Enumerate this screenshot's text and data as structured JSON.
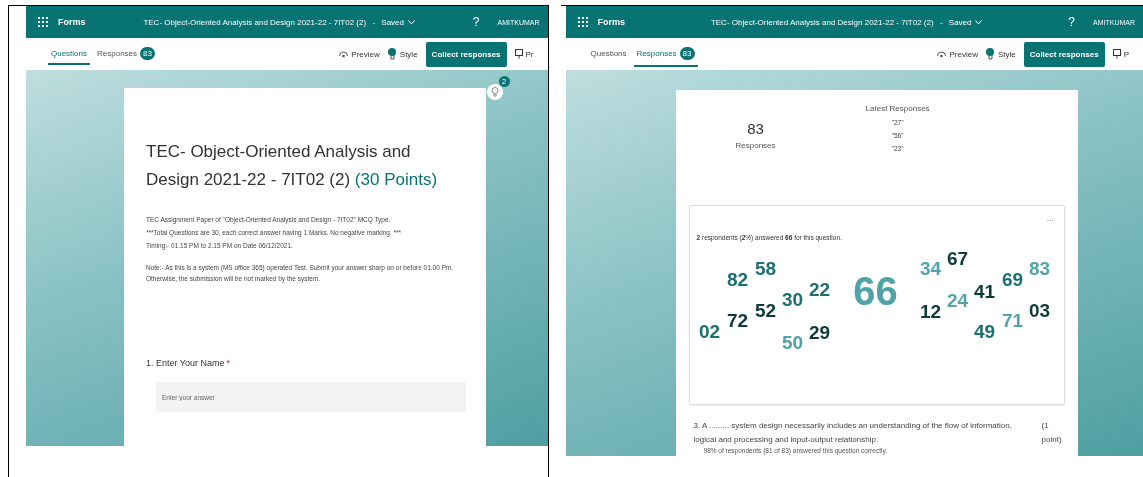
{
  "screens": [
    {
      "kind": "questions",
      "app": "Forms",
      "title": "TEC- Object-Oriented Analysis and Design 2021-22 - 7IT02 (2)",
      "separator": "-",
      "status": "Saved",
      "help": "?",
      "user": "AMITKUMAR",
      "tabs": [
        {
          "label": "Questions",
          "selected": true
        },
        {
          "label": "Responses",
          "selected": false,
          "count": "83"
        }
      ],
      "actions": {
        "preview": "Preview",
        "style": "Style",
        "collect": "Collect responses",
        "cut": "Pr"
      },
      "badge": "2",
      "form": {
        "title": "TEC- Object-Oriented Analysis and Design 2021-22 - 7IT02 (2)",
        "points": "(30 Points)",
        "description": [
          "TEC Assignment Paper of \"Object-Oriented Analysis and Design - 7IT02\" MCQ Type.",
          "***Total Questions are 30, each correct answer having 1 Marks. No negative marking. ***",
          "Timing:- 01.15 PM to 2.15 PM on Date 06/12/2021."
        ],
        "note": "Note:- As this is a system (MS office 365) operated  Test. Submit your answer sharp on or before 01.00 Pm. Otherwise, the submission will be not marked by the system.",
        "question": {
          "label": "1. Enter Your Name",
          "required": true,
          "required_mark": "*",
          "placeholder": "Enter your answer"
        }
      }
    },
    {
      "kind": "responses",
      "app": "Forms",
      "title": "TEC- Object-Oriented Analysis and Design 2021-22 - 7IT02 (2)",
      "separator": "-",
      "status": "Saved",
      "help": "?",
      "user": "AMITKUMAR",
      "tabs": [
        {
          "label": "Questions",
          "selected": false
        },
        {
          "label": "Responses",
          "selected": true,
          "count": "83"
        }
      ],
      "actions": {
        "preview": "Preview",
        "style": "Style",
        "collect": "Collect responses",
        "cut": "P"
      },
      "summary": {
        "count": "83",
        "count_label": "Responses",
        "latest_label": "Latest Responses",
        "latest": [
          "\"27\"",
          "\"56\"",
          "\"23\""
        ]
      },
      "cloud_card": {
        "menu": "...",
        "sentence": "**2** respondents (**2**%) answered **66** for this question.",
        "words": [
          {
            "text": "02",
            "color": "#1a7072",
            "kind": "normal"
          },
          {
            "text": "72",
            "color": "#0d3a3c",
            "kind": "normal"
          },
          {
            "text": "82",
            "color": "#1a7072",
            "kind": "normal"
          },
          {
            "text": "58",
            "color": "#1a7072",
            "kind": "normal"
          },
          {
            "text": "52",
            "color": "#0d3a3c",
            "kind": "normal"
          },
          {
            "text": "30",
            "color": "#1a7072",
            "kind": "normal"
          },
          {
            "text": "50",
            "color": "#52a3a7",
            "kind": "normal"
          },
          {
            "text": "22",
            "color": "#1a7072",
            "kind": "normal"
          },
          {
            "text": "29",
            "color": "#0d3a3c",
            "kind": "normal"
          },
          {
            "text": "66",
            "color": "#52a3a7",
            "kind": "large"
          },
          {
            "text": "34",
            "color": "#52a3a7",
            "kind": "normal"
          },
          {
            "text": "67",
            "color": "#0d3a3c",
            "kind": "normal"
          },
          {
            "text": "12",
            "color": "#0d3a3c",
            "kind": "normal"
          },
          {
            "text": "24",
            "color": "#52a3a7",
            "kind": "normal"
          },
          {
            "text": "41",
            "color": "#0d3a3c",
            "kind": "normal"
          },
          {
            "text": "49",
            "color": "#1a7072",
            "kind": "normal"
          },
          {
            "text": "69",
            "color": "#1a7072",
            "kind": "normal"
          },
          {
            "text": "71",
            "color": "#52a3a7",
            "kind": "normal"
          },
          {
            "text": "83",
            "color": "#52a3a7",
            "kind": "normal"
          },
          {
            "text": "03",
            "color": "#0d3a3c",
            "kind": "normal"
          }
        ]
      },
      "next_question": {
        "text": "3. A ......... system design necessarily includes an understanding of the flow of information, logical and processing and input-output relationship.",
        "points": "(1 point)",
        "stat": "98% of respondents (81 of 83) answered this question correctly."
      }
    }
  ]
}
